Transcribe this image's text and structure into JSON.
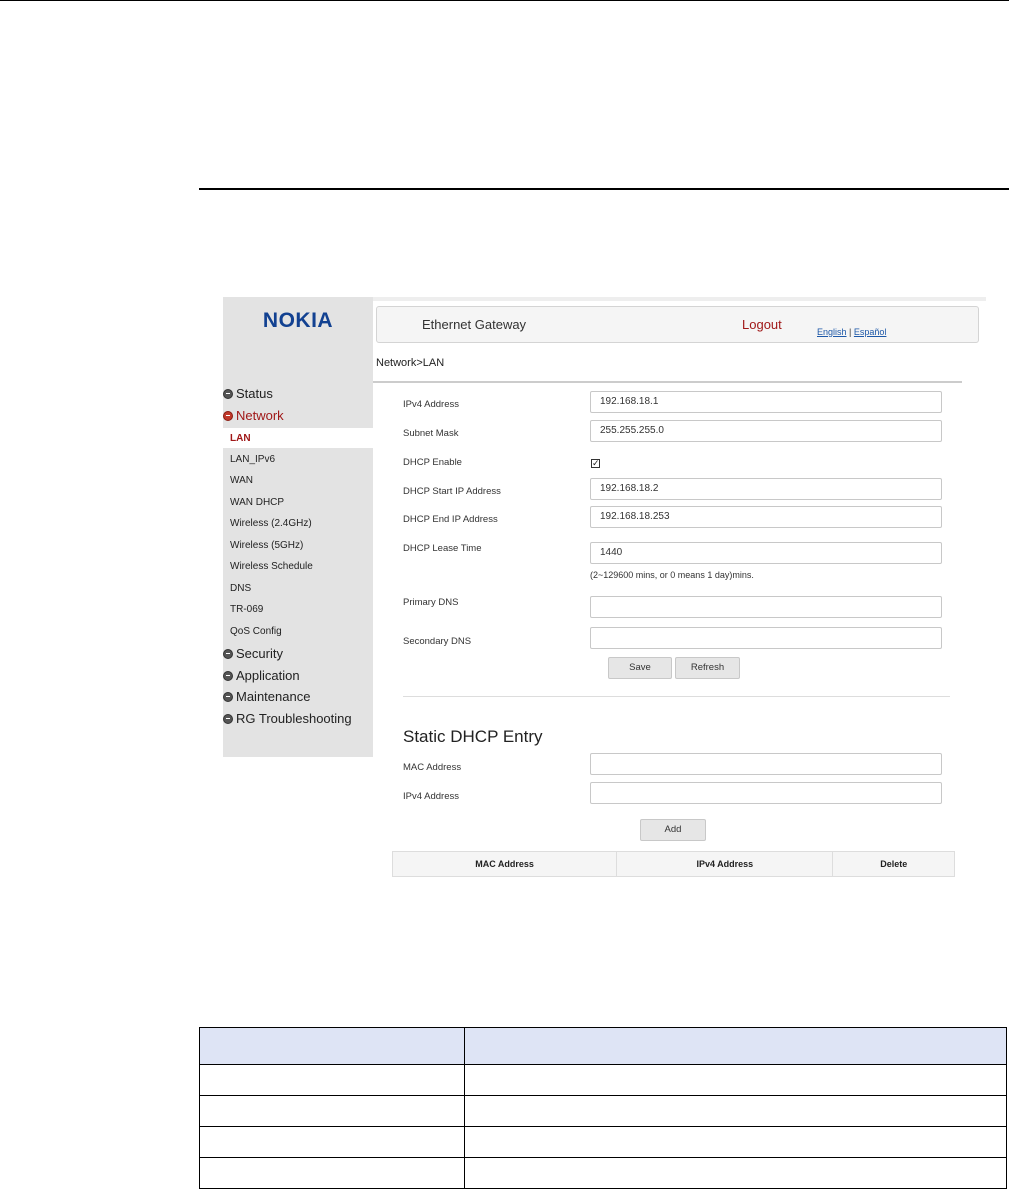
{
  "header": {
    "logo": "NOKIA",
    "title": "Ethernet Gateway",
    "logout": "Logout",
    "lang_english": "English",
    "lang_sep": "|",
    "lang_spanish": "Español"
  },
  "breadcrumb": "Network>LAN",
  "sidebar": {
    "categories": [
      {
        "label": "Status",
        "active": false
      },
      {
        "label": "Network",
        "active": true
      },
      {
        "label": "Security",
        "active": false
      },
      {
        "label": "Application",
        "active": false
      },
      {
        "label": "Maintenance",
        "active": false
      },
      {
        "label": "RG Troubleshooting",
        "active": false
      }
    ],
    "network_items": [
      "LAN",
      "LAN_IPv6",
      "WAN",
      "WAN DHCP",
      "Wireless (2.4GHz)",
      "Wireless (5GHz)",
      "Wireless Schedule",
      "DNS",
      "TR-069",
      "QoS Config"
    ]
  },
  "form": {
    "ipv4_label": "IPv4 Address",
    "ipv4_value": "192.168.18.1",
    "mask_label": "Subnet Mask",
    "mask_value": "255.255.255.0",
    "dhcp_enable_label": "DHCP Enable",
    "dhcp_enable_checked": true,
    "start_label": "DHCP Start IP Address",
    "start_value": "192.168.18.2",
    "end_label": "DHCP End IP Address",
    "end_value": "192.168.18.253",
    "lease_label": "DHCP Lease Time",
    "lease_value": "1440",
    "lease_hint": "(2~129600 mins, or 0 means 1 day)mins.",
    "primary_dns_label": "Primary DNS",
    "primary_dns_value": "",
    "secondary_dns_label": "Secondary DNS",
    "secondary_dns_value": "",
    "save_button": "Save",
    "refresh_button": "Refresh"
  },
  "static_dhcp": {
    "title": "Static DHCP Entry",
    "mac_label": "MAC Address",
    "mac_value": "",
    "ipv4_label": "IPv4 Address",
    "ipv4_value": "",
    "add_button": "Add",
    "columns": [
      "MAC Address",
      "IPv4 Address",
      "Delete"
    ]
  },
  "doc_table": {
    "rows": 5,
    "header_color": "#dee4f5"
  }
}
